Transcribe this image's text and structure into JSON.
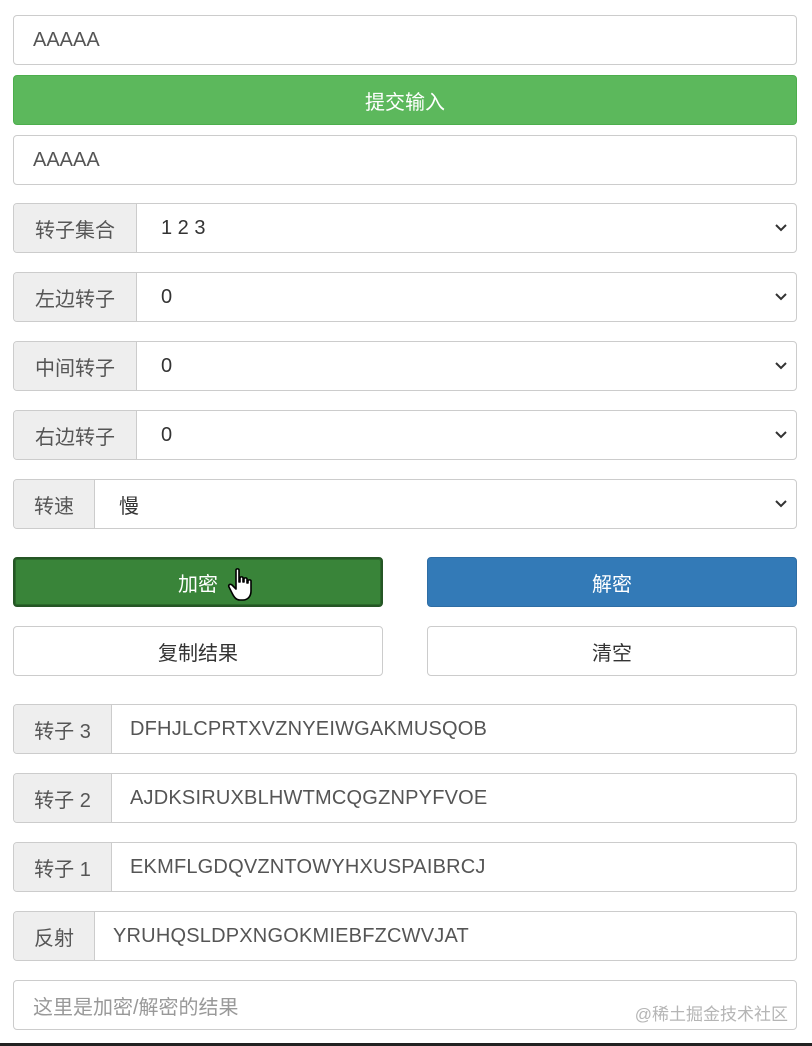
{
  "input": {
    "value": "AAAAA"
  },
  "submit_button": "提交输入",
  "input_echo": {
    "value": "AAAAA"
  },
  "selects": {
    "rotor_set": {
      "label": "转子集合",
      "value": "1 2 3"
    },
    "left_rotor": {
      "label": "左边转子",
      "value": "0"
    },
    "middle_rotor": {
      "label": "中间转子",
      "value": "0"
    },
    "right_rotor": {
      "label": "右边转子",
      "value": "0"
    },
    "speed": {
      "label": "转速",
      "value": "慢"
    }
  },
  "buttons": {
    "encrypt": "加密",
    "decrypt": "解密",
    "copy": "复制结果",
    "clear": "清空"
  },
  "rotors": {
    "rotor3": {
      "label": "转子 3",
      "value": "DFHJLCPRTXVZNYEIWGAKMUSQOB"
    },
    "rotor2": {
      "label": "转子 2",
      "value": "AJDKSIRUXBLHWTMCQGZNPYFVOE"
    },
    "rotor1": {
      "label": "转子 1",
      "value": "EKMFLGDQVZNTOWYHXUSPAIBRCJ"
    },
    "reflector": {
      "label": "反射",
      "value": "YRUHQSLDPXNGOKMIEBFZCWVJAT"
    }
  },
  "result": {
    "placeholder": "这里是加密/解密的结果"
  },
  "watermark": "@稀土掘金技术社区",
  "colors": {
    "success": "#5cb85c",
    "success_active": "#398439",
    "primary": "#337ab7"
  }
}
